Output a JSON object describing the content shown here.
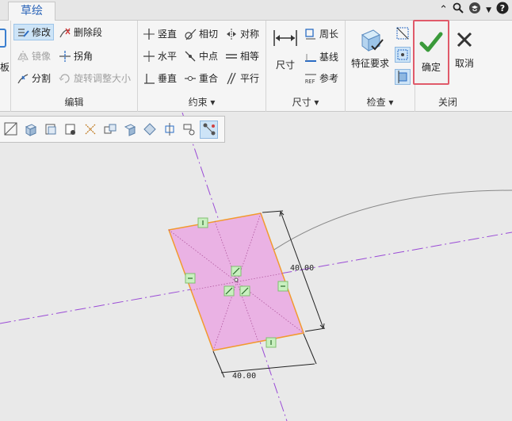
{
  "tab": {
    "label": "草绘"
  },
  "ribbon": {
    "edit_group": {
      "label": "编辑",
      "items": {
        "modify": "修改",
        "delete_segment": "删除段",
        "mirror": "镜像",
        "corner": "拐角",
        "divide": "分割",
        "rotate_resize": "旋转调整大小"
      }
    },
    "constraint_group": {
      "label": "约束 ▾",
      "items": {
        "vertical": "竖直",
        "tangent": "相切",
        "symmetric": "对称",
        "horizontal": "水平",
        "midpoint": "中点",
        "equal": "相等",
        "perpendicular": "垂直",
        "coincident": "重合",
        "parallel": "平行"
      }
    },
    "dimension_group": {
      "label": "尺寸 ▾",
      "items": {
        "dimension": "尺寸",
        "perimeter": "周长",
        "baseline": "基线",
        "reference": "参考"
      }
    },
    "inspect_group": {
      "label": "检查 ▾",
      "items": {
        "feature_requirements": "特征要求"
      }
    },
    "close_group": {
      "label": "关闭",
      "items": {
        "ok": "确定",
        "cancel": "取消"
      }
    },
    "left_cut_label": "板"
  },
  "sketch": {
    "dimension_height": "40.00",
    "dimension_width": "40.00"
  },
  "colors": {
    "rect_fill": "#eab2e4",
    "rect_edge": "#f29a2e",
    "centerline": "#9a4bd6",
    "ok_border": "#e05a6a",
    "ok_check": "#3a9a3a"
  }
}
